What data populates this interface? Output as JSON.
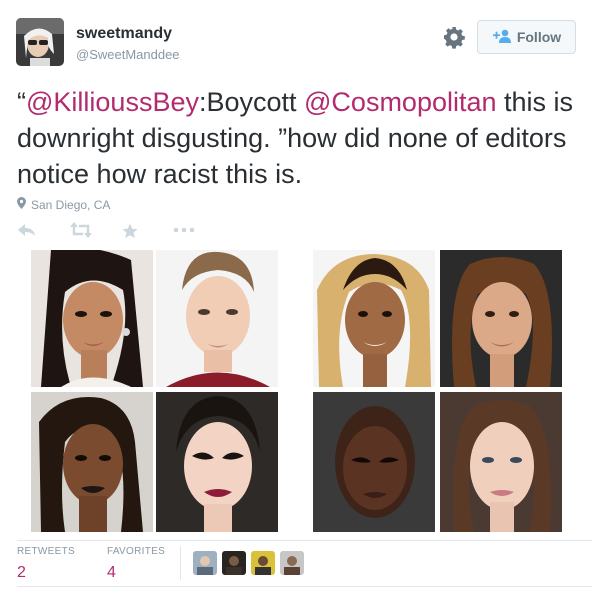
{
  "user": {
    "name": "sweetmandy",
    "handle": "@SweetManddee"
  },
  "follow": {
    "label": "Follow"
  },
  "tweet": {
    "open_quote": "“",
    "mention1": "@KillioussBey",
    "colon_text": ":Boycott ",
    "mention2": "@Cosmopolitan",
    "rest": " this is downright disgusting. ”how did none of editors notice how racist this is."
  },
  "location": "San Diego, CA",
  "stats": {
    "retweets_label": "RETWEETS",
    "retweets_value": "2",
    "favorites_label": "FAVORITES",
    "favorites_value": "4"
  },
  "icons": {
    "gear": "gear-icon",
    "follow": "add-user-icon",
    "location": "map-pin-icon",
    "reply": "reply-icon",
    "retweet": "retweet-icon",
    "favorite": "star-icon",
    "more": "more-icon"
  },
  "colors": {
    "mention": "#b22b6e",
    "muted": "#8899a6",
    "text": "#292f33"
  }
}
